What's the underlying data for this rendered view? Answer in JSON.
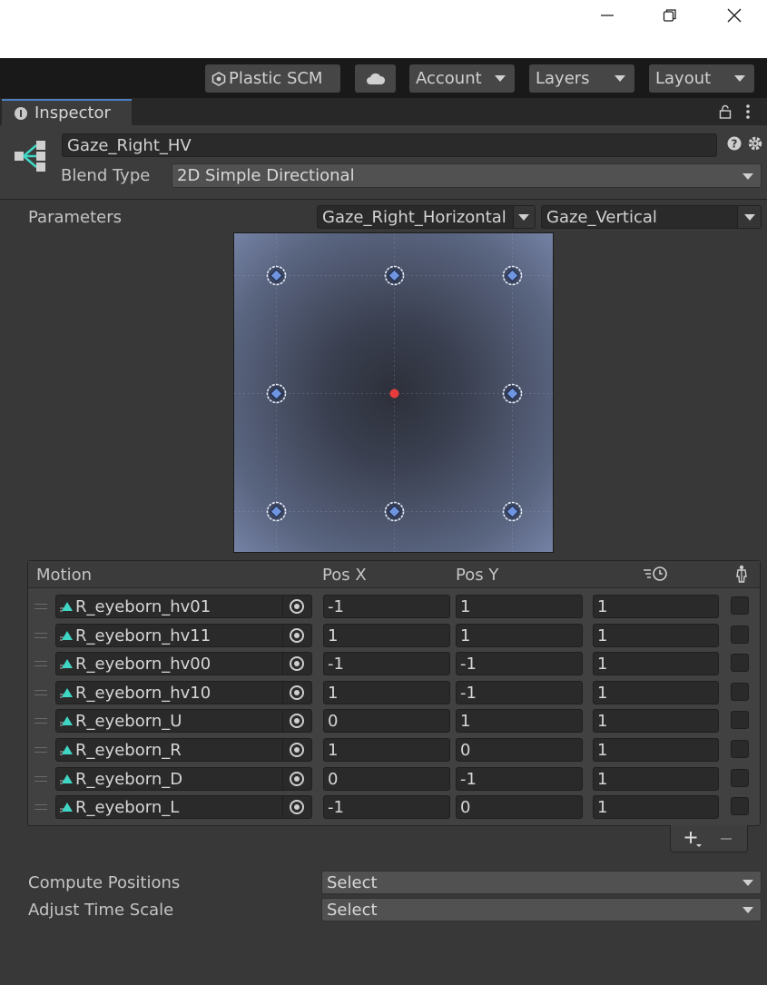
{
  "window": {
    "minimize_icon": "minimize-icon",
    "restore_icon": "restore-icon",
    "close_icon": "close-icon"
  },
  "toolbar": {
    "plastic": "Plastic SCM",
    "account": "Account",
    "layers": "Layers",
    "layout": "Layout"
  },
  "tab": {
    "label": "Inspector"
  },
  "header": {
    "name_value": "Gaze_Right_HV",
    "blend_type_label": "Blend Type",
    "blend_type_value": "2D Simple Directional"
  },
  "parameters": {
    "label": "Parameters",
    "param_x": "Gaze_Right_Horizontal",
    "param_y": "Gaze_Vertical"
  },
  "graph": {
    "motion_points": [
      [
        -1,
        1
      ],
      [
        0,
        1
      ],
      [
        1,
        1
      ],
      [
        -1,
        0
      ],
      [
        1,
        0
      ],
      [
        -1,
        -1
      ],
      [
        0,
        -1
      ],
      [
        1,
        -1
      ]
    ],
    "current_point": [
      0,
      0
    ],
    "range": [
      -1,
      1
    ],
    "point_color": "#6f95e0",
    "current_color": "#e83c3c"
  },
  "motion_table": {
    "headers": {
      "motion": "Motion",
      "pos_x": "Pos X",
      "pos_y": "Pos Y"
    },
    "rows": [
      {
        "motion": "R_eyeborn_hv01",
        "pos_x": "-1",
        "pos_y": "1",
        "speed": "1"
      },
      {
        "motion": "R_eyeborn_hv11",
        "pos_x": "1",
        "pos_y": "1",
        "speed": "1"
      },
      {
        "motion": "R_eyeborn_hv00",
        "pos_x": "-1",
        "pos_y": "-1",
        "speed": "1"
      },
      {
        "motion": "R_eyeborn_hv10",
        "pos_x": "1",
        "pos_y": "-1",
        "speed": "1"
      },
      {
        "motion": "R_eyeborn_U",
        "pos_x": "0",
        "pos_y": "1",
        "speed": "1"
      },
      {
        "motion": "R_eyeborn_R",
        "pos_x": "1",
        "pos_y": "0",
        "speed": "1"
      },
      {
        "motion": "R_eyeborn_D",
        "pos_x": "0",
        "pos_y": "-1",
        "speed": "1"
      },
      {
        "motion": "R_eyeborn_L",
        "pos_x": "-1",
        "pos_y": "0",
        "speed": "1"
      }
    ]
  },
  "footer": {
    "compute_label": "Compute Positions",
    "compute_value": "Select",
    "adjust_label": "Adjust Time Scale",
    "adjust_value": "Select"
  }
}
